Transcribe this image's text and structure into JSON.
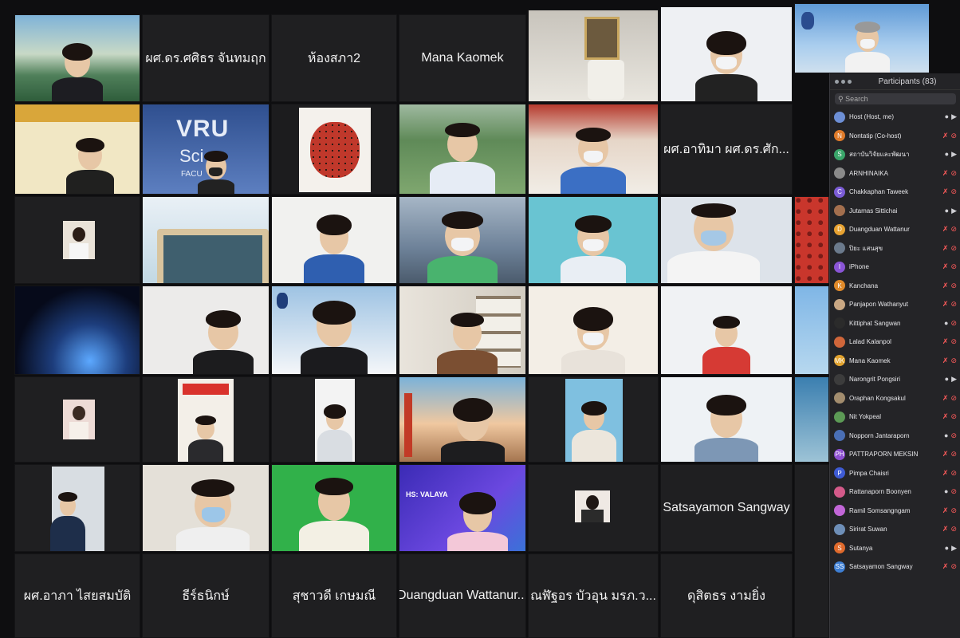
{
  "panel": {
    "title": "Participants (83)",
    "search_placeholder": "Search",
    "items": [
      {
        "initial": "",
        "name": "Host (Host, me)",
        "color": "#6d8fd6",
        "mic": "on",
        "video": "on"
      },
      {
        "initial": "N",
        "name": "Nontatip (Co-host)",
        "color": "#e07b2a",
        "mic": "off",
        "video": "off"
      },
      {
        "initial": "S",
        "name": "สถาบันวิจัยและพัฒนา",
        "color": "#3aa66a",
        "mic": "on",
        "video": "on"
      },
      {
        "initial": "",
        "name": "ARNHINAIKA",
        "color": "#8a8a8a",
        "mic": "off",
        "video": "off"
      },
      {
        "initial": "C",
        "name": "Chakkaphan Taweek",
        "color": "#7b5cd6",
        "mic": "off",
        "video": "off"
      },
      {
        "initial": "",
        "name": "Jutamas Sittichai",
        "color": "#a36f4e",
        "mic": "on",
        "video": "on"
      },
      {
        "initial": "D",
        "name": "Duangduan Wattanur",
        "color": "#e7a231",
        "mic": "off",
        "video": "off"
      },
      {
        "initial": "",
        "name": "ปิยะ แสนสุข",
        "color": "#6b7a8c",
        "mic": "off",
        "video": "off"
      },
      {
        "initial": "I",
        "name": "iPhone",
        "color": "#8a55d6",
        "mic": "off",
        "video": "off"
      },
      {
        "initial": "K",
        "name": "Kanchana",
        "color": "#e08a2a",
        "mic": "off",
        "video": "off"
      },
      {
        "initial": "",
        "name": "Panjapon Wathanyut",
        "color": "#c9a783",
        "mic": "off",
        "video": "off"
      },
      {
        "initial": "",
        "name": "Kittiphat Sangwan",
        "color": "#2b2b2b",
        "mic": "on",
        "video": "off"
      },
      {
        "initial": "",
        "name": "Lalad Kalanpol",
        "color": "#d0663a",
        "mic": "off",
        "video": "off"
      },
      {
        "initial": "MK",
        "name": "Mana Kaomek",
        "color": "#e2a32e",
        "mic": "off",
        "video": "off"
      },
      {
        "initial": "",
        "name": "Narongrit Pongsiri",
        "color": "#3c3c3c",
        "mic": "on",
        "video": "on"
      },
      {
        "initial": "",
        "name": "Oraphan Kongsakul",
        "color": "#a38d6e",
        "mic": "off",
        "video": "off"
      },
      {
        "initial": "",
        "name": "Nit Yokpeal",
        "color": "#5c9a55",
        "mic": "off",
        "video": "off"
      },
      {
        "initial": "",
        "name": "Nopporn Jantaraporn",
        "color": "#4a6fb5",
        "mic": "on",
        "video": "off"
      },
      {
        "initial": "PH",
        "name": "PATTRAPORN MEKSIN",
        "color": "#8d4fd0",
        "mic": "off",
        "video": "off"
      },
      {
        "initial": "P",
        "name": "Pimpa Chaisri",
        "color": "#3e5bd4",
        "mic": "off",
        "video": "off"
      },
      {
        "initial": "",
        "name": "Rattanaporn Boonyen",
        "color": "#d45a8a",
        "mic": "on",
        "video": "off"
      },
      {
        "initial": "",
        "name": "Ramil Somsangngam",
        "color": "#c266d8",
        "mic": "off",
        "video": "off"
      },
      {
        "initial": "",
        "name": "Sirirat Suwan",
        "color": "#6e8fb8",
        "mic": "off",
        "video": "off"
      },
      {
        "initial": "S",
        "name": "Sutanya",
        "color": "#e06a2c",
        "mic": "on",
        "video": "on"
      },
      {
        "initial": "SS",
        "name": "Satsayamon Sangway",
        "color": "#3e7fd4",
        "mic": "off",
        "video": "off"
      }
    ]
  },
  "tiles": {
    "name1": "ผศ.ดร.ศศิธร จันทมฤก",
    "name2": "ห้องสภา2",
    "name3": "Mana Kaomek",
    "name4": "ผศ.อาทิมา ผศ.ดร.ศัก...",
    "name5": "Satsayamon Sangway",
    "name6": "ผศ.อาภา ไสยสมบัติ",
    "name7": "ธีร์ธนิกษ์",
    "name8": "สุชาวดี เกษมณี",
    "name9": "Duangduan Wattanur...",
    "name10": "ณฬัฐอร บัวอุน มรภ.ว...",
    "name11": "ดุสิตธร งามยิ่ง",
    "vru_text1": "VRU",
    "vru_text2": "Sci",
    "vru_text3": "FACU",
    "hs_title": "HS: VALAYA"
  }
}
